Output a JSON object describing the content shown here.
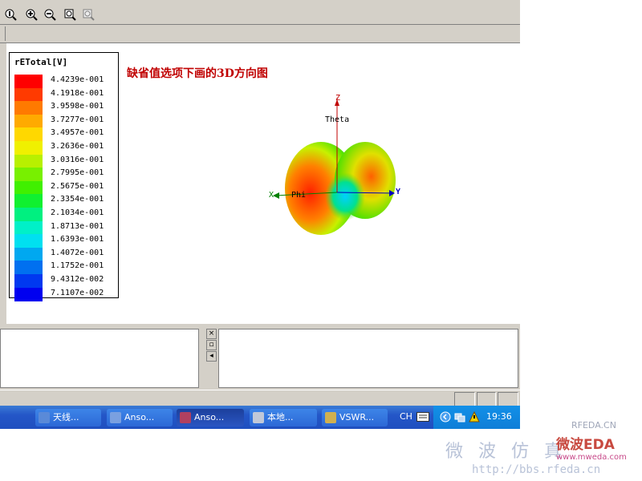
{
  "legend": {
    "title": "rETotal[V]",
    "entries": [
      {
        "value": "4.4239e-001",
        "color": "#ff0000"
      },
      {
        "value": "4.1918e-001",
        "color": "#ff3a00"
      },
      {
        "value": "3.9598e-001",
        "color": "#ff7a00"
      },
      {
        "value": "3.7277e-001",
        "color": "#ffaa00"
      },
      {
        "value": "3.4957e-001",
        "color": "#ffd800"
      },
      {
        "value": "3.2636e-001",
        "color": "#f0f000"
      },
      {
        "value": "3.0316e-001",
        "color": "#b8f000"
      },
      {
        "value": "2.7995e-001",
        "color": "#78f000"
      },
      {
        "value": "2.5675e-001",
        "color": "#40f000"
      },
      {
        "value": "2.3354e-001",
        "color": "#10f030"
      },
      {
        "value": "2.1034e-001",
        "color": "#00f080"
      },
      {
        "value": "1.8713e-001",
        "color": "#00f0c8"
      },
      {
        "value": "1.6393e-001",
        "color": "#00e0f0"
      },
      {
        "value": "1.4072e-001",
        "color": "#00a8f0"
      },
      {
        "value": "1.1752e-001",
        "color": "#0070f0"
      },
      {
        "value": "9.4312e-002",
        "color": "#0038f0"
      },
      {
        "value": "7.1107e-002",
        "color": "#0000f0"
      }
    ]
  },
  "plot": {
    "title": "缺省值选项下画的3D方向图",
    "axis_z": "Z",
    "axis_y": "Y",
    "axis_x": "X",
    "theta_label": "Theta",
    "phi_label": "Phi"
  },
  "taskbar": {
    "items": [
      {
        "label": "天线...",
        "icon_color": "#5a8ad8"
      },
      {
        "label": "Anso...",
        "icon_color": "#7aa0e0"
      },
      {
        "label": "Anso...",
        "icon_color": "#b04060"
      },
      {
        "label": "本地...",
        "icon_color": "#c0c8d8"
      },
      {
        "label": "VSWR...",
        "icon_color": "#d0b050"
      }
    ],
    "lang": "CH",
    "clock": "19:36"
  },
  "watermark": {
    "rfeda": "RFEDA.CN",
    "cn_text": "微 波 仿 真",
    "eda_text": "微波EDA",
    "site": "www.mweda.com",
    "url": "http://bbs.rfeda.cn"
  }
}
